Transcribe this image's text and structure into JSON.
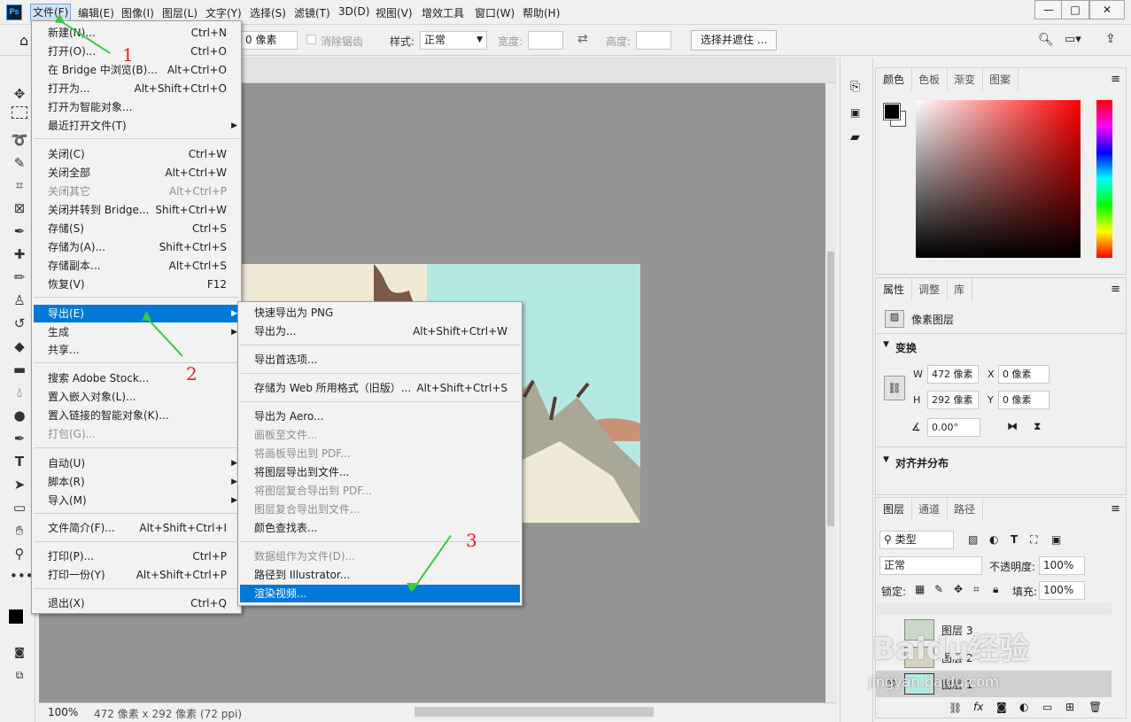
{
  "app": {
    "logo": "Ps"
  },
  "menubar": {
    "items": [
      "文件(F)",
      "编辑(E)",
      "图像(I)",
      "图层(L)",
      "文字(Y)",
      "选择(S)",
      "滤镜(T)",
      "3D(D)",
      "视图(V)",
      "增效工具",
      "窗口(W)",
      "帮助(H)"
    ]
  },
  "window_controls": [
    "—",
    "□",
    "✕"
  ],
  "options": {
    "feather_value": "0 像素",
    "antialias": "消除锯齿",
    "style_label": "样式:",
    "style_value": "正常",
    "width_label": "宽度:",
    "height_label": "高度:",
    "select_mask": "选择并遮住 ..."
  },
  "status": {
    "zoom": "100%",
    "info": "472 像素 x 292 像素 (72 ppi)"
  },
  "file_menu": [
    {
      "label": "新建(N)...",
      "shortcut": "Ctrl+N"
    },
    {
      "label": "打开(O)...",
      "shortcut": "Ctrl+O"
    },
    {
      "label": "在 Bridge 中浏览(B)...",
      "shortcut": "Alt+Ctrl+O"
    },
    {
      "label": "打开为...",
      "shortcut": "Alt+Shift+Ctrl+O"
    },
    {
      "label": "打开为智能对象...",
      "shortcut": ""
    },
    {
      "label": "最近打开文件(T)",
      "shortcut": ""
    },
    {
      "label": "关闭(C)",
      "shortcut": "Ctrl+W"
    },
    {
      "label": "关闭全部",
      "shortcut": "Alt+Ctrl+W"
    },
    {
      "label": "关闭其它",
      "shortcut": "Alt+Ctrl+P"
    },
    {
      "label": "关闭并转到 Bridge...",
      "shortcut": "Shift+Ctrl+W"
    },
    {
      "label": "存储(S)",
      "shortcut": "Ctrl+S"
    },
    {
      "label": "存储为(A)...",
      "shortcut": "Shift+Ctrl+S"
    },
    {
      "label": "存储副本...",
      "shortcut": "Alt+Ctrl+S"
    },
    {
      "label": "恢复(V)",
      "shortcut": "F12"
    },
    {
      "label": "导出(E)",
      "shortcut": ""
    },
    {
      "label": "生成",
      "shortcut": ""
    },
    {
      "label": "共享...",
      "shortcut": ""
    },
    {
      "label": "搜索 Adobe Stock...",
      "shortcut": ""
    },
    {
      "label": "置入嵌入对象(L)...",
      "shortcut": ""
    },
    {
      "label": "置入链接的智能对象(K)...",
      "shortcut": ""
    },
    {
      "label": "打包(G)...",
      "shortcut": ""
    },
    {
      "label": "自动(U)",
      "shortcut": ""
    },
    {
      "label": "脚本(R)",
      "shortcut": ""
    },
    {
      "label": "导入(M)",
      "shortcut": ""
    },
    {
      "label": "文件简介(F)...",
      "shortcut": "Alt+Shift+Ctrl+I"
    },
    {
      "label": "打印(P)...",
      "shortcut": "Ctrl+P"
    },
    {
      "label": "打印一份(Y)",
      "shortcut": "Alt+Shift+Ctrl+P"
    },
    {
      "label": "退出(X)",
      "shortcut": "Ctrl+Q"
    }
  ],
  "export_menu": [
    {
      "label": "快速导出为 PNG",
      "shortcut": ""
    },
    {
      "label": "导出为...",
      "shortcut": "Alt+Shift+Ctrl+W"
    },
    {
      "label": "导出首选项...",
      "shortcut": ""
    },
    {
      "label": "存储为 Web 所用格式（旧版）...",
      "shortcut": "Alt+Shift+Ctrl+S"
    },
    {
      "label": "导出为 Aero...",
      "shortcut": ""
    },
    {
      "label": "画板至文件...",
      "shortcut": ""
    },
    {
      "label": "将画板导出到 PDF...",
      "shortcut": ""
    },
    {
      "label": "将图层导出到文件...",
      "shortcut": ""
    },
    {
      "label": "将图层复合导出到 PDF...",
      "shortcut": ""
    },
    {
      "label": "图层复合导出到文件...",
      "shortcut": ""
    },
    {
      "label": "颜色查找表...",
      "shortcut": ""
    },
    {
      "label": "数据组作为文件(D)...",
      "shortcut": ""
    },
    {
      "label": "路径到 Illustrator...",
      "shortcut": ""
    },
    {
      "label": "渲染视频...",
      "shortcut": ""
    }
  ],
  "color_panel": {
    "tabs": [
      "颜色",
      "色板",
      "渐变",
      "图案"
    ]
  },
  "properties_panel": {
    "tabs": [
      "属性",
      "调整",
      "库"
    ],
    "layer_type": "像素图层",
    "transform_title": "变换",
    "w_label": "W",
    "w_value": "472 像素",
    "h_label": "H",
    "h_value": "292 像素",
    "x_label": "X",
    "x_value": "0 像素",
    "y_label": "Y",
    "y_value": "0 像素",
    "angle_value": "0.00°",
    "align_title": "对齐并分布"
  },
  "layers_panel": {
    "tabs": [
      "图层",
      "通道",
      "路径"
    ],
    "filter": "类型",
    "blend_mode": "正常",
    "opacity_label": "不透明度:",
    "opacity_value": "100%",
    "lock_label": "锁定:",
    "fill_label": "填充:",
    "fill_value": "100%",
    "layers": [
      "图层 3",
      "图层 2",
      "图层 1"
    ]
  },
  "annotations": [
    "1",
    "2",
    "3"
  ],
  "watermark": "Baidu经验",
  "watermark_url": "jingyan.baidu.com"
}
